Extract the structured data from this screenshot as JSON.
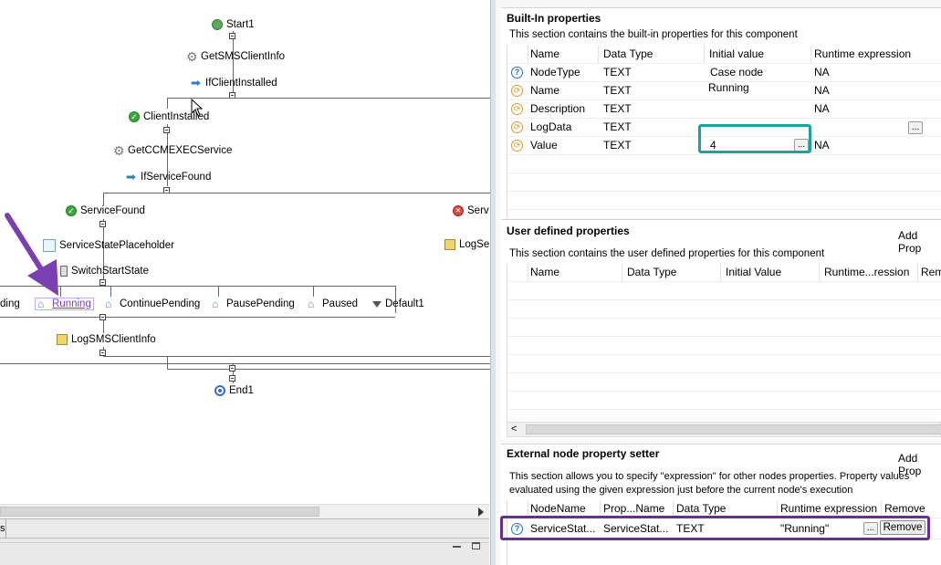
{
  "workflow": {
    "nodes": {
      "start": "Start1",
      "get_sms_client_info": "GetSMSClientInfo",
      "if_client_installed": "IfClientInstalled",
      "client_installed": "ClientInstalled",
      "get_ccmexec_service": "GetCCMEXECService",
      "if_service_found": "IfServiceFound",
      "service_found": "ServiceFound",
      "service_partial": "Serv",
      "service_state_placeholder": "ServiceStatePlaceholder",
      "log_partial": "LogSer",
      "switch_start_state": "SwitchStartState",
      "pending_partial": "ding",
      "running": "Running",
      "continue_pending": "ContinuePending",
      "pause_pending": "PausePending",
      "paused": "Paused",
      "default1": "Default1",
      "log_sms_client_info": "LogSMSClientInfo",
      "end": "End1"
    },
    "tab_partial": "s"
  },
  "builtin": {
    "title": "Built-In properties",
    "description": "This section contains the built-in properties for this component",
    "columns": [
      "Name",
      "Data Type",
      "Initial value",
      "Runtime expression"
    ],
    "rows": [
      {
        "icon": "question-icon",
        "name": "NodeType",
        "type": "TEXT",
        "initial": "Case node",
        "runtime": "NA"
      },
      {
        "icon": "property-icon",
        "name": "Name",
        "type": "TEXT",
        "initial": "Running",
        "runtime": "NA"
      },
      {
        "icon": "property-icon",
        "name": "Description",
        "type": "TEXT",
        "initial": "",
        "runtime": "NA"
      },
      {
        "icon": "property-icon",
        "name": "LogData",
        "type": "TEXT",
        "initial": "",
        "runtime": ""
      },
      {
        "icon": "property-icon",
        "name": "Value",
        "type": "TEXT",
        "initial": "4",
        "runtime": "NA"
      }
    ],
    "ellipsis": "..."
  },
  "user_defined": {
    "title": "User defined properties",
    "add_label": "Add Prop",
    "description": "This section contains the user defined properties for this component",
    "columns": [
      "Name",
      "Data Type",
      "Initial Value",
      "Runtime...ression",
      "Rem"
    ]
  },
  "external": {
    "title": "External node property setter",
    "add_label": "Add Prop",
    "description_line1": "This section allows you to specify \"expression\" for other nodes properties. Property values",
    "description_line2": "evaluated using the given expression just before the current node's execution",
    "columns": [
      "NodeName",
      "Prop...Name",
      "Data Type",
      "Runtime expression",
      "Remove"
    ],
    "row": {
      "icon": "question-icon",
      "node_name": "ServiceStat...",
      "prop_name": "ServiceStat...",
      "type": "TEXT",
      "runtime": "\"Running\"",
      "ellipsis": "...",
      "remove": "Remove"
    }
  },
  "colors": {
    "teal_highlight": "#1aa39a",
    "purple_highlight": "#6a2d91",
    "purple_arrow": "#7a3fb0"
  }
}
